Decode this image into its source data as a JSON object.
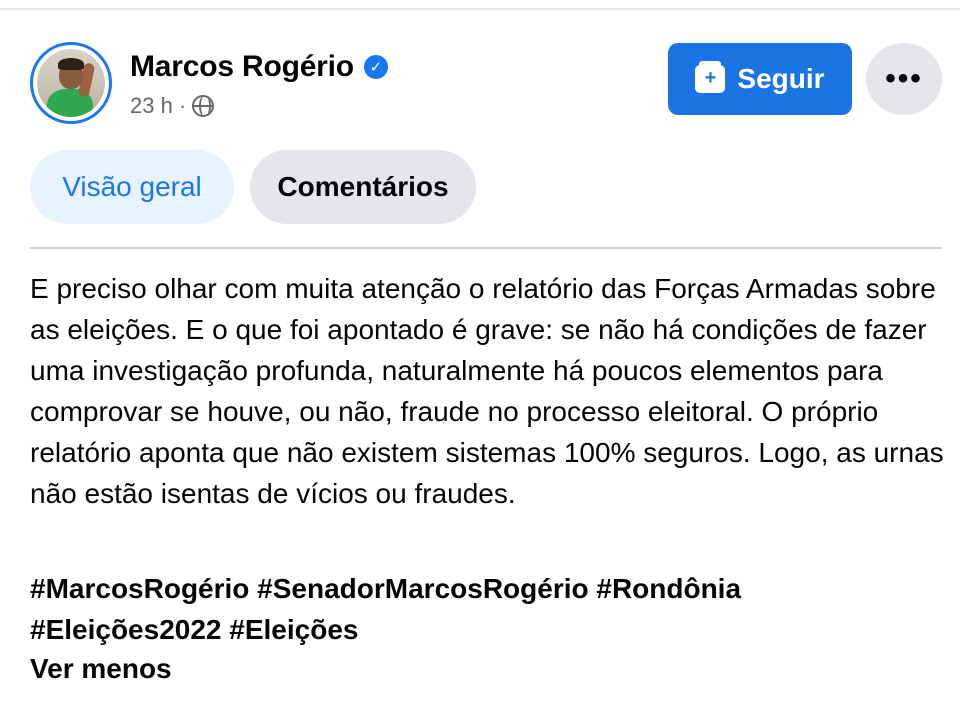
{
  "post": {
    "author": "Marcos Rogério",
    "time": "23 h",
    "separator": "·",
    "verified_icon": "verified-check-icon",
    "privacy_icon": "globe-icon",
    "text": "E preciso olhar com muita atenção o relatório das Forças Armadas sobre as eleições. E o que foi apontado é grave: se não há condições de fazer uma investigação profunda, naturalmente há poucos elementos para comprovar se houve, ou não, fraude no processo eleitoral. O próprio relatório aponta que não existem sistemas 100% seguros. Logo, as urnas não estão isentas de vícios ou fraudes.",
    "hashtags_line1": "#MarcosRogério #SenadorMarcosRogério #Rondônia",
    "hashtags_line2": "#Eleições2022 #Eleições",
    "see_less": "Ver menos"
  },
  "actions": {
    "follow_label": "Seguir",
    "more_label": "•••"
  },
  "tabs": [
    {
      "label": "Visão geral",
      "active": true
    },
    {
      "label": "Comentários",
      "active": false
    }
  ],
  "colors": {
    "accent": "#1877f2",
    "follow_bg": "#1b74e4",
    "secondary_bg": "#e4e6eb",
    "muted_text": "#65676b"
  }
}
